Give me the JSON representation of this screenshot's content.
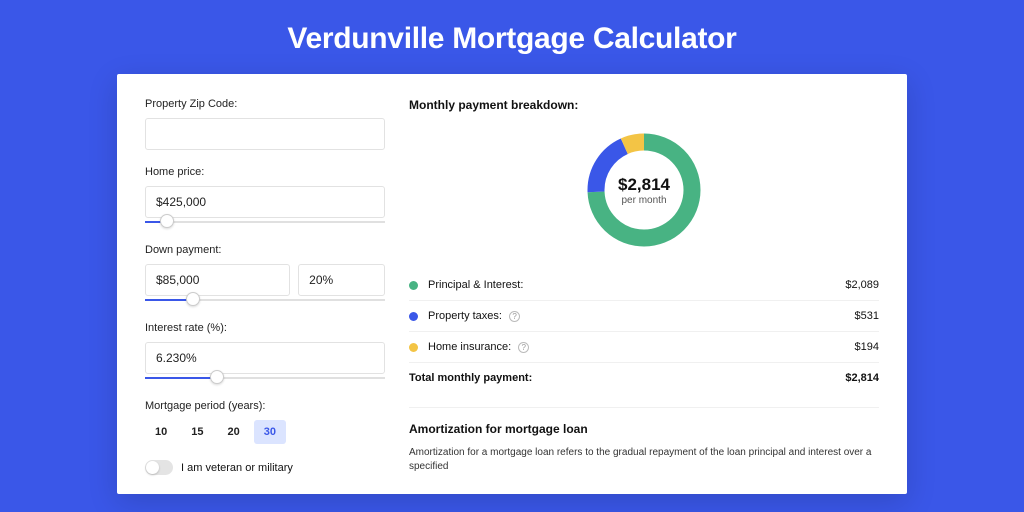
{
  "page_title": "Verdunville Mortgage Calculator",
  "form": {
    "zip_label": "Property Zip Code:",
    "zip_value": "",
    "home_price_label": "Home price:",
    "home_price_value": "$425,000",
    "home_price_slider_pct": 9,
    "down_payment_label": "Down payment:",
    "down_payment_value": "$85,000",
    "down_payment_pct_value": "20%",
    "down_payment_slider_pct": 20,
    "interest_label": "Interest rate (%):",
    "interest_value": "6.230%",
    "interest_slider_pct": 30,
    "period_label": "Mortgage period (years):",
    "period_options": [
      "10",
      "15",
      "20",
      "30"
    ],
    "period_selected": "30",
    "veteran_label": "I am veteran or military"
  },
  "breakdown": {
    "title": "Monthly payment breakdown:",
    "amount": "$2,814",
    "sub": "per month",
    "items": [
      {
        "label": "Principal & Interest:",
        "value": "$2,089",
        "color": "green",
        "info": false
      },
      {
        "label": "Property taxes:",
        "value": "$531",
        "color": "blue",
        "info": true
      },
      {
        "label": "Home insurance:",
        "value": "$194",
        "color": "yellow",
        "info": true
      }
    ],
    "total_label": "Total monthly payment:",
    "total_value": "$2,814"
  },
  "chart_data": {
    "type": "pie",
    "title": "Monthly payment breakdown",
    "series": [
      {
        "name": "Principal & Interest",
        "value": 2089,
        "color": "#48b383"
      },
      {
        "name": "Property taxes",
        "value": 531,
        "color": "#3a57e8"
      },
      {
        "name": "Home insurance",
        "value": 194,
        "color": "#f3c445"
      }
    ],
    "total": 2814,
    "center_label": "$2,814",
    "center_sub": "per month"
  },
  "amortization": {
    "title": "Amortization for mortgage loan",
    "text": "Amortization for a mortgage loan refers to the gradual repayment of the loan principal and interest over a specified"
  }
}
